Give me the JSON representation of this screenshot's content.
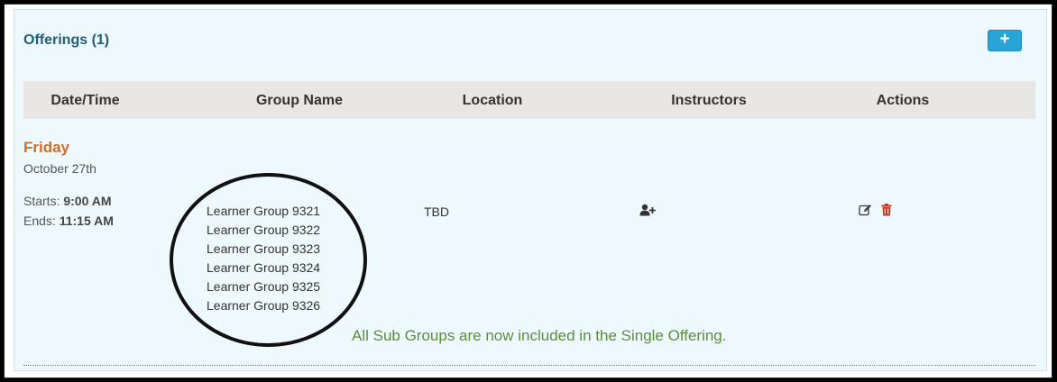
{
  "panel": {
    "title": "Offerings (1)",
    "add_button_label": "+"
  },
  "table": {
    "columns": [
      "Date/Time",
      "Group Name",
      "Location",
      "Instructors",
      "Actions"
    ]
  },
  "offering": {
    "day": "Friday",
    "date": "October 27th",
    "starts_label": "Starts:",
    "starts_time": "9:00 AM",
    "ends_label": "Ends:",
    "ends_time": "11:15 AM",
    "groups": [
      "Learner Group 9321",
      "Learner Group 9322",
      "Learner Group 9323",
      "Learner Group 9324",
      "Learner Group 9325",
      "Learner Group 9326"
    ],
    "location": "TBD"
  },
  "annotation": {
    "note": "All Sub Groups are now included in the Single Offering."
  },
  "icons": {
    "add": "plus-icon",
    "instructors": "user-plus-icon",
    "edit": "edit-icon",
    "delete": "trash-icon"
  },
  "colors": {
    "title": "#1f5d7a",
    "accent_button": "#2aa4d6",
    "day": "#cc6f2c",
    "note": "#5a8e3a",
    "delete": "#c0392b"
  }
}
